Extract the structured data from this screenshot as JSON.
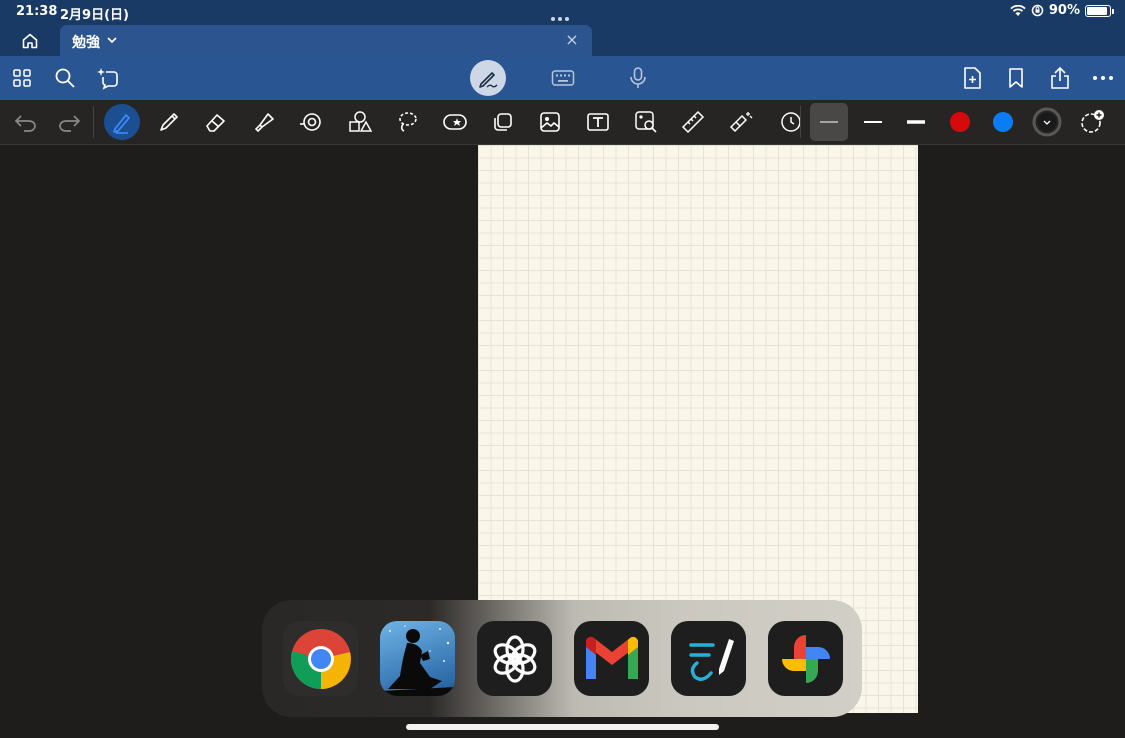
{
  "status": {
    "time": "21:38",
    "date": "2月9日(日)",
    "battery": "90%",
    "battery_level": 0.9
  },
  "tab": {
    "title": "勉強",
    "close": "×"
  },
  "toolbar": {
    "left_icons": [
      "grid-icon",
      "search-icon",
      "sparkle-lasso-icon"
    ],
    "center_icons": [
      "pen-mode-icon",
      "keyboard-icon",
      "microphone-icon"
    ],
    "right_icons": [
      "add-page-icon",
      "bookmark-icon",
      "share-icon",
      "more-icon"
    ]
  },
  "tools": {
    "items": [
      "undo",
      "redo",
      "pen",
      "pencil",
      "eraser",
      "highlighter",
      "tape",
      "shapes",
      "lasso",
      "sticker",
      "elements",
      "image",
      "text",
      "image-search",
      "ruler",
      "laser",
      "timer"
    ],
    "strokes": [
      "thin",
      "medium",
      "thick"
    ],
    "colors": [
      "#d50a0a",
      "#0a7cf5",
      "#1a1a1a"
    ]
  },
  "dock": {
    "apps": [
      "Chrome",
      "Kindle",
      "ChatGPT",
      "Gmail",
      "Freeform",
      "Google Photos"
    ]
  }
}
